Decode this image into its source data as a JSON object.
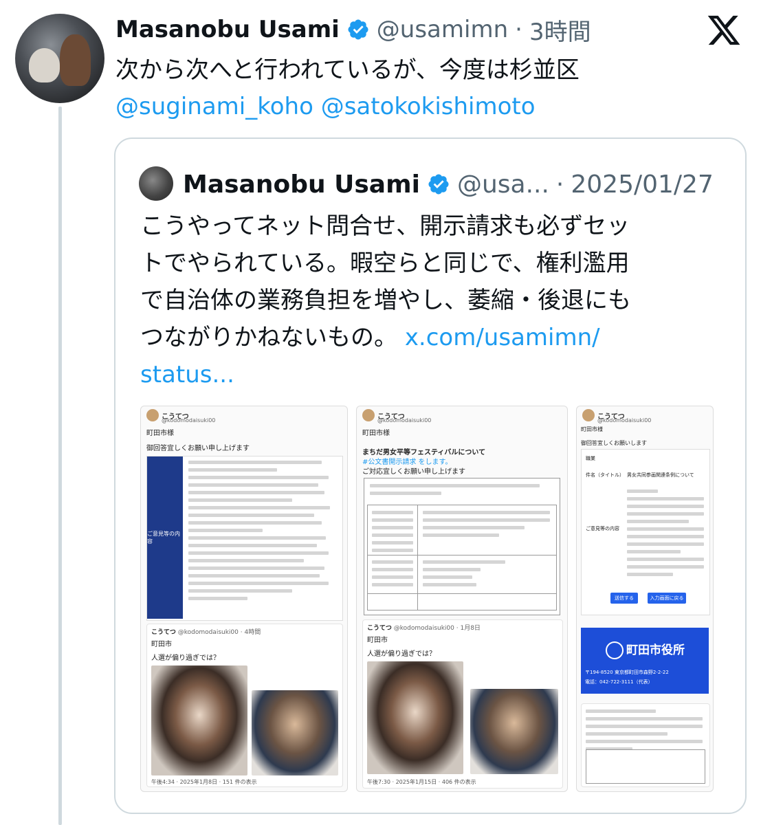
{
  "tweet": {
    "author_name": "Masanobu Usami",
    "handle": "@usamimn",
    "separator": "·",
    "time": "3時間",
    "text_line1": "次から次へと行われているが、今度は杉並区",
    "mentions": [
      "@suginami_koho",
      "@satokokishimoto"
    ]
  },
  "quote": {
    "author_name": "Masanobu Usami",
    "handle": "@usa...",
    "separator": "·",
    "date": "2025/01/27",
    "text_lines": [
      "こうやってネット問合せ、開示請求も必ずセッ",
      "トでやられている。暇空らと同じで、権利濫用",
      "で自治体の業務負担を増やし、萎縮・後退にも",
      "つながりかねないもの。"
    ],
    "link_part1": "x.com/usamimn/",
    "link_part2": "status..."
  },
  "images": {
    "img1": {
      "name": "こうてつ",
      "handle": "@kodomodaisuki00",
      "addressee": "町田市様",
      "request": "御回答宜しくお願い申し上げます",
      "side_label": "ご意見等の内容",
      "inner_name": "こうてつ",
      "inner_handle": "@kodomodaisuki00 · 4時間",
      "inner_city": "町田市",
      "inner_question": "人選が偏り過ぎでは？",
      "footer": "午後4:34 · 2025年1月8日 · 151 件の表示"
    },
    "img2": {
      "name": "こうてつ",
      "handle": "@kodomodaisuki00",
      "addressee": "町田市様",
      "title": "まちだ男女平等フェスティバルについて",
      "hashtag": "#公文書開示請求 をします。",
      "request": "ご対応宜しくお願い申し上げます",
      "inner_name": "こうてつ",
      "inner_handle": "@kodomodaisuki00 · 1月8日",
      "inner_city": "町田市",
      "inner_question": "人選が偏り過ぎでは？",
      "footer": "午後7:30 · 2025年1月15日 · 406 件の表示"
    },
    "img3": {
      "name": "こうてつ",
      "handle": "@kodomodaisuki00",
      "addressee": "町田市様",
      "request": "御回答宜しくお願いします",
      "row1": "職業",
      "row2_label": "件名（タイトル）",
      "row2_value": "男女共同参画関連条例について",
      "row3_label": "ご意見等の内容",
      "btn1": "送信する",
      "btn2": "入力画面に戻る",
      "city": "町田市役所",
      "address": "〒194-8520 東京都町田市森野2-2-22",
      "phone": "電話：042-722-3111（代表）"
    }
  },
  "colors": {
    "accent": "#1d9bf0",
    "verified": "#1d9bf0",
    "secondary_text": "#536471",
    "border": "#cfd9de"
  }
}
